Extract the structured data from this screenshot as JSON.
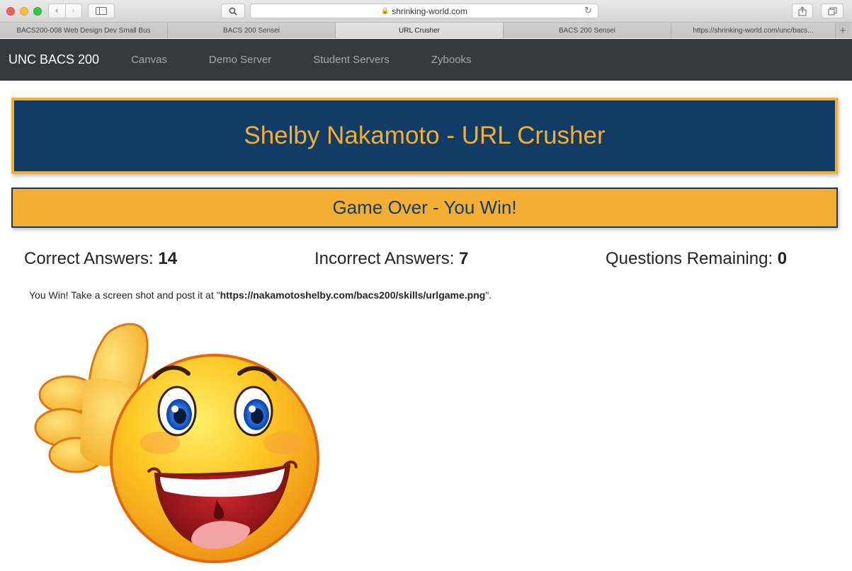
{
  "browser": {
    "url": "shrinking-world.com",
    "tabs": [
      {
        "label": "BACS200-008 Web Design Dev Small Bus",
        "active": false
      },
      {
        "label": "BACS 200 Sensei",
        "active": false
      },
      {
        "label": "URL Crusher",
        "active": true
      },
      {
        "label": "BACS 200 Sensei",
        "active": false
      },
      {
        "label": "https://shrinking-world.com/unc/bacs...",
        "active": false
      }
    ]
  },
  "navbar": {
    "brand": "UNC BACS 200",
    "links": [
      "Canvas",
      "Demo Server",
      "Student Servers",
      "Zybooks"
    ]
  },
  "page": {
    "title": "Shelby Nakamoto - URL Crusher",
    "status": "Game Over - You Win!",
    "scores": [
      {
        "label": "Correct Answers:",
        "value": "14"
      },
      {
        "label": "Incorrect Answers:",
        "value": "7"
      },
      {
        "label": "Questions Remaining:",
        "value": "0"
      }
    ],
    "message_prefix": "You Win! Take a screen shot and post it at \"",
    "message_url": "https://nakamotoshelby.com/bacs200/skills/urlgame.png",
    "message_suffix": "\"."
  },
  "colors": {
    "navy": "#103c66",
    "gold": "#f4ae33",
    "navbar": "#343a40"
  },
  "image": {
    "name": "thumbs-up-smiley-emoji"
  }
}
